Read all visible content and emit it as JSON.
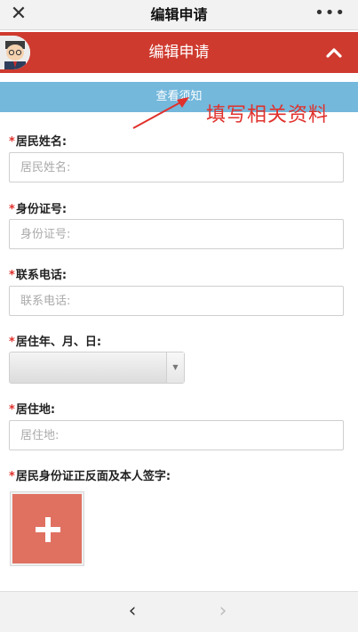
{
  "window": {
    "title": "编辑申请",
    "close_glyph": "✕",
    "more_glyph": "•••"
  },
  "header": {
    "title": "编辑申请",
    "avatar_icon": "user-avatar",
    "collapse_icon": "chevron-up-icon"
  },
  "notice": {
    "link_label": "查看须知"
  },
  "annotation": {
    "text": "填写相关资料"
  },
  "form": {
    "required_mark": "*",
    "name": {
      "label": "居民姓名:",
      "placeholder": "居民姓名:"
    },
    "id_number": {
      "label": "身份证号:",
      "placeholder": "身份证号:"
    },
    "phone": {
      "label": "联系电话:",
      "placeholder": "联系电话:"
    },
    "residence_date": {
      "label": "居住年、月、日:",
      "selected": ""
    },
    "address": {
      "label": "居住地:",
      "placeholder": "居住地:"
    },
    "id_upload": {
      "label": "居民身份证正反面及本人签字:"
    }
  },
  "nav": {
    "back_glyph": "‹",
    "forward_glyph": "›"
  },
  "colors": {
    "header_red": "#cf3a2e",
    "notice_blue": "#74b8dc",
    "upload_tile": "#e07161",
    "annotation_red": "#e0312c"
  }
}
